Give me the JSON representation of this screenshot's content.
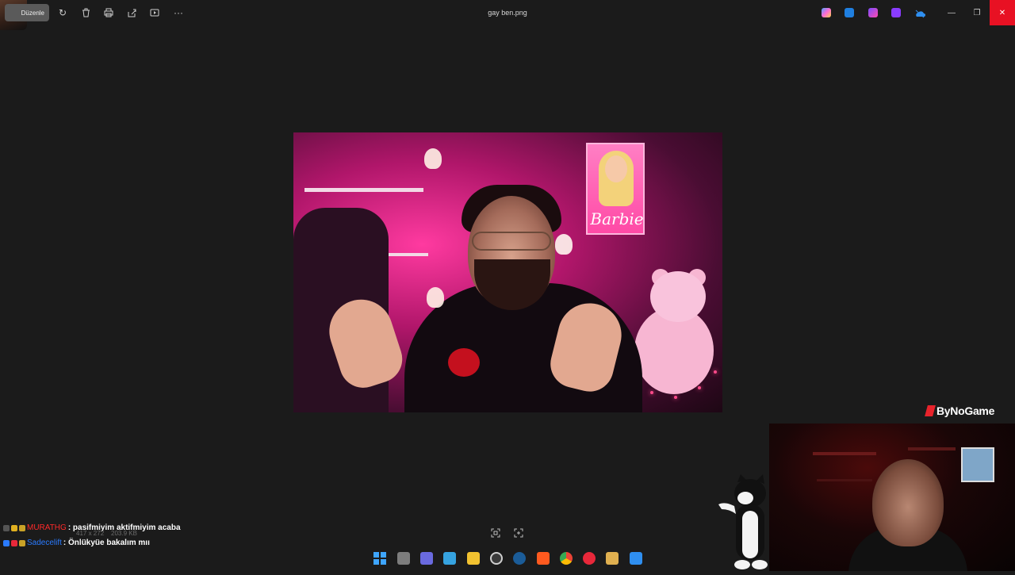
{
  "titlebar": {
    "edit_label": "Düzenle",
    "file_title": "gay ben.png",
    "toolbar_icons": [
      "rotate-icon",
      "delete-icon",
      "print-icon",
      "share-icon",
      "slideshow-icon",
      "more-icon"
    ],
    "tray_icons": [
      "copilot-icon",
      "edit-app-icon",
      "clipchamp-icon",
      "video-editor-icon",
      "onedrive-icon"
    ]
  },
  "chat": {
    "messages": [
      {
        "user": "MURATHG",
        "user_color": "#ff2a2a",
        "text": ": pasifmiyim aktifmiyim acaba"
      },
      {
        "user": "Sadecelift",
        "user_color": "#2a7bff",
        "text": ": Önlükyüe bakalım mıı"
      }
    ],
    "image_info": {
      "dimensions": "417 x 272",
      "size": "203.9 KB"
    }
  },
  "viewer": {
    "bottom_tools": [
      "fit-icon",
      "fullscreen-icon"
    ]
  },
  "overlay": {
    "brand": "ByNoGame"
  },
  "taskbar": {
    "apps": [
      {
        "name": "start-icon",
        "color": "#3ea5ff"
      },
      {
        "name": "task-view-icon",
        "color": "#9a9a9a"
      },
      {
        "name": "task-manager-icon",
        "color": "#7a7aff"
      },
      {
        "name": "photos-app-icon",
        "color": "#36a3e0"
      },
      {
        "name": "file-explorer-icon",
        "color": "#f2c230"
      },
      {
        "name": "obs-icon",
        "color": "#cfcfcf"
      },
      {
        "name": "steam-icon",
        "color": "#3b8ed0"
      },
      {
        "name": "brave-icon",
        "color": "#ff5a1f"
      },
      {
        "name": "chrome-icon",
        "color": "#34a853"
      },
      {
        "name": "recorder-icon",
        "color": "#e8283a"
      },
      {
        "name": "media-player-icon",
        "color": "#f0c060"
      },
      {
        "name": "paint-icon",
        "color": "#2f8ff0"
      }
    ]
  }
}
